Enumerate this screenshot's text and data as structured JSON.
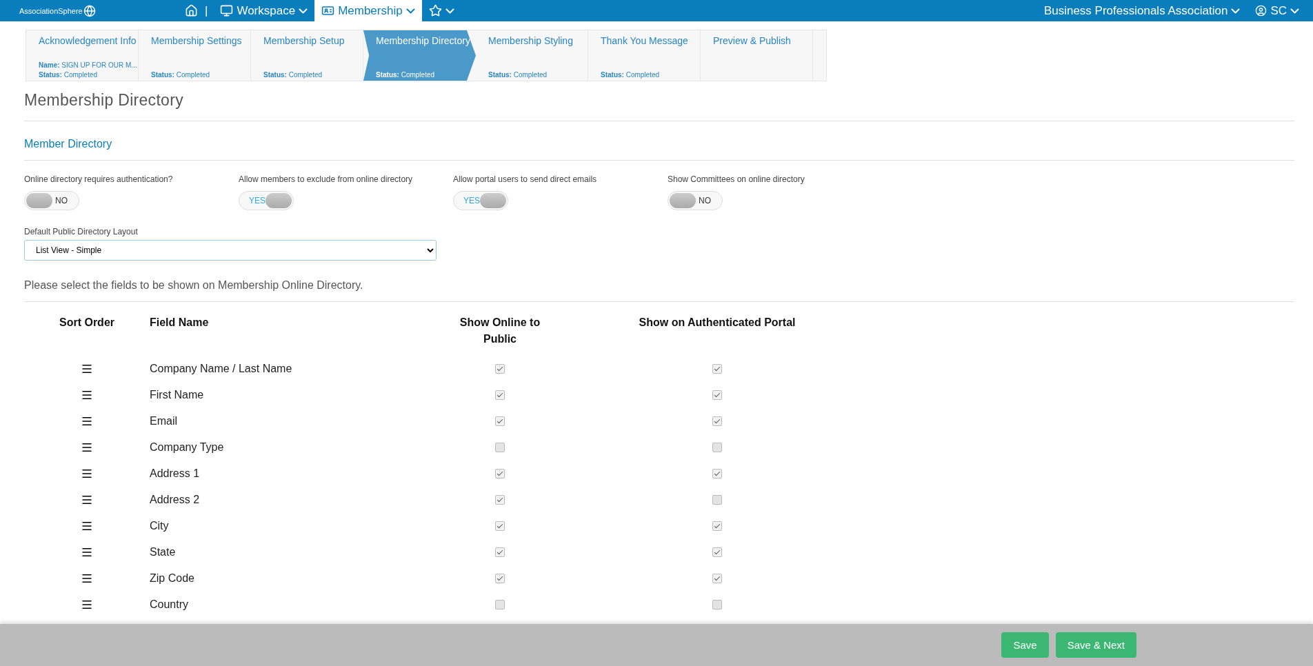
{
  "topbar": {
    "logo": "AssociationSphere",
    "divider": "|",
    "menus": [
      {
        "kind": "home",
        "selected": false
      },
      {
        "kind": "workspace",
        "label": "Workspace",
        "selected": false
      },
      {
        "kind": "membership",
        "label": "Membership",
        "selected": true
      },
      {
        "kind": "favorites",
        "selected": false
      }
    ],
    "organization": "Business Professionals Association",
    "user": "SC"
  },
  "steps": [
    {
      "title": "Acknowledgement Info",
      "name_label": "Name:",
      "name": "SIGN UP FOR OUR M...",
      "status_label": "Status:",
      "status": "Completed",
      "selected": false
    },
    {
      "title": "Membership Settings",
      "status_label": "Status:",
      "status": "Completed",
      "selected": false
    },
    {
      "title": "Membership Setup",
      "status_label": "Status:",
      "status": "Completed",
      "selected": false
    },
    {
      "title": "Membership Directory",
      "status_label": "Status:",
      "status": "Completed",
      "selected": true
    },
    {
      "title": "Membership Styling",
      "status_label": "Status:",
      "status": "Completed",
      "selected": false
    },
    {
      "title": "Thank You Message",
      "status_label": "Status:",
      "status": "Completed",
      "selected": false
    },
    {
      "title": "Preview & Publish",
      "selected": false
    }
  ],
  "page_title": "Membership Directory",
  "section_title": "Member Directory",
  "toggles": [
    {
      "label": "Online directory requires authentication?",
      "on": false,
      "text": "NO"
    },
    {
      "label": "Allow members to exclude from online directory",
      "on": true,
      "text": "YES"
    },
    {
      "label": "Allow portal users to send direct emails",
      "on": true,
      "text": "YES"
    },
    {
      "label": "Show Committees on online directory",
      "on": false,
      "text": "NO"
    }
  ],
  "layout_select": {
    "label": "Default Public Directory Layout",
    "value": "List View - Simple"
  },
  "instructions": "Please select the fields to be shown on Membership Online Directory.",
  "table": {
    "columns": [
      "Sort Order",
      "Field Name",
      "Show Online to Public",
      "Show on Authenticated Portal"
    ],
    "rows": [
      {
        "name": "Company Name / Last Name",
        "public": true,
        "portal": true
      },
      {
        "name": "First Name",
        "public": true,
        "portal": true
      },
      {
        "name": "Email",
        "public": true,
        "portal": true
      },
      {
        "name": "Company Type",
        "public": false,
        "portal": false
      },
      {
        "name": "Address 1",
        "public": true,
        "portal": true
      },
      {
        "name": "Address 2",
        "public": true,
        "portal": false
      },
      {
        "name": "City",
        "public": true,
        "portal": true
      },
      {
        "name": "State",
        "public": true,
        "portal": true
      },
      {
        "name": "Zip Code",
        "public": true,
        "portal": true
      },
      {
        "name": "Country",
        "public": false,
        "portal": false
      }
    ]
  },
  "footer": {
    "buttons": [
      "Save",
      "Save & Next"
    ]
  }
}
